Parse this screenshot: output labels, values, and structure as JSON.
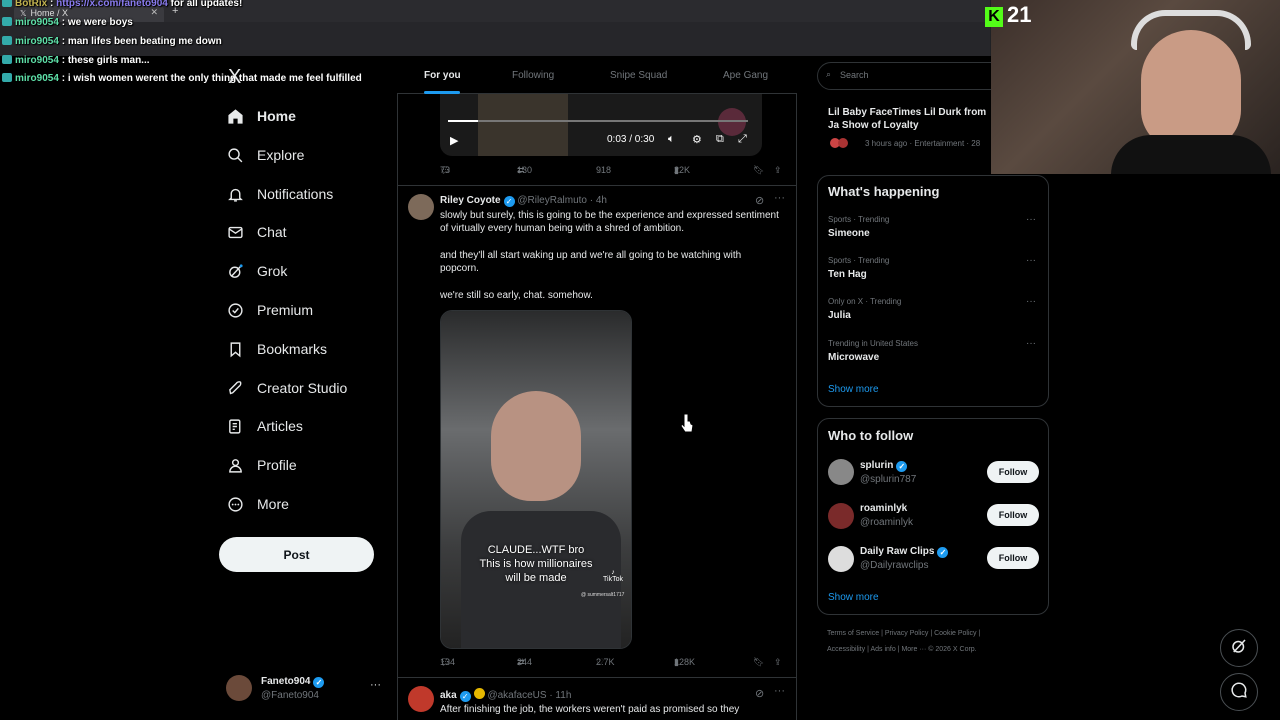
{
  "browser": {
    "tab_title": "Home / X"
  },
  "chat": [
    {
      "user": "BotRix",
      "sep": " : ",
      "link": "https://x.com/faneto904",
      "msg": " for all updates!"
    },
    {
      "user": "miro9054",
      "sep": " : ",
      "msg": "we were boys"
    },
    {
      "user": "miro9054",
      "sep": " : ",
      "msg": "man lifes been beating me down"
    },
    {
      "user": "miro9054",
      "sep": " : ",
      "msg": "these girls man..."
    },
    {
      "user": "miro9054",
      "sep": " : ",
      "msg": "i wish women werent the only thing that made me feel fulfilled"
    }
  ],
  "overlay": {
    "viewer_count": "21"
  },
  "nav": {
    "logo": "X",
    "items": [
      {
        "label": "Home",
        "icon": "home-icon"
      },
      {
        "label": "Explore",
        "icon": "search-icon"
      },
      {
        "label": "Notifications",
        "icon": "bell-icon"
      },
      {
        "label": "Chat",
        "icon": "mail-icon"
      },
      {
        "label": "Grok",
        "icon": "grok-icon"
      },
      {
        "label": "Premium",
        "icon": "premium-icon"
      },
      {
        "label": "Bookmarks",
        "icon": "bookmark-icon"
      },
      {
        "label": "Creator Studio",
        "icon": "rocket-icon"
      },
      {
        "label": "Articles",
        "icon": "articles-icon"
      },
      {
        "label": "Profile",
        "icon": "person-icon"
      },
      {
        "label": "More",
        "icon": "more-circle-icon"
      }
    ],
    "post": "Post",
    "account": {
      "name": "Faneto904",
      "handle": "@Faneto904",
      "more": "···"
    }
  },
  "timeline": {
    "tabs": [
      "For you",
      "Following",
      "Snipe Squad",
      "Ape Gang"
    ],
    "video_time": "0:03 / 0:30",
    "tweet1_stats": {
      "replies": "73",
      "retweets": "130",
      "likes": "918",
      "views": "22K"
    },
    "tweet2": {
      "name": "Riley Coyote",
      "handle": "@RileyRalmuto",
      "time": "· 4h",
      "p1": "slowly but surely, this is going to be the experience and expressed sentiment of virtually every human being with a shred of ambition.",
      "p2": "and they'll all start waking up and we're all going to be watching with popcorn.",
      "p3": "we're still so early, chat. somehow.",
      "caption": "CLAUDE...WTF bro\nThis is how millionaires\nwill be made",
      "tiktok": "TikTok",
      "tiktok_user": "@ summersalt1717",
      "stats": {
        "replies": "134",
        "retweets": "244",
        "likes": "2.7K",
        "views": "128K"
      }
    },
    "tweet3": {
      "name": "aka",
      "handle": "@akafaceUS",
      "time": "· 11h",
      "text": "After finishing the job, the workers weren't paid as promised so they"
    }
  },
  "sidebar": {
    "search_placeholder": "Search",
    "news": {
      "title": "Lil Baby FaceTimes Lil Durk from Ja Show of Loyalty",
      "meta": "3 hours ago · Entertainment · 28"
    },
    "happening_title": "What's happening",
    "trends": [
      {
        "meta": "Sports · Trending",
        "name": "Simeone"
      },
      {
        "meta": "Sports · Trending",
        "name": "Ten Hag"
      },
      {
        "meta": "Only on X · Trending",
        "name": "Julia"
      },
      {
        "meta": "Trending in United States",
        "name": "Microwave"
      }
    ],
    "show_more": "Show more",
    "who_title": "Who to follow",
    "who": [
      {
        "name": "splurin",
        "handle": "@splurin787",
        "verified": true
      },
      {
        "name": "roaminlyk",
        "handle": "@roaminlyk",
        "verified": false
      },
      {
        "name": "Daily Raw Clips",
        "handle": "@Dailyrawclips",
        "verified": true
      }
    ],
    "follow_label": "Follow",
    "footer_line1": "Terms of Service  |   Privacy Policy  |   Cookie Policy  |",
    "footer_line2": "Accessibility  |   Ads info  |   More ···   © 2026 X Corp."
  },
  "colors": {
    "accent": "#1d9bf0",
    "bg": "#000000",
    "border": "#2f3336",
    "kick": "#53fc18"
  }
}
